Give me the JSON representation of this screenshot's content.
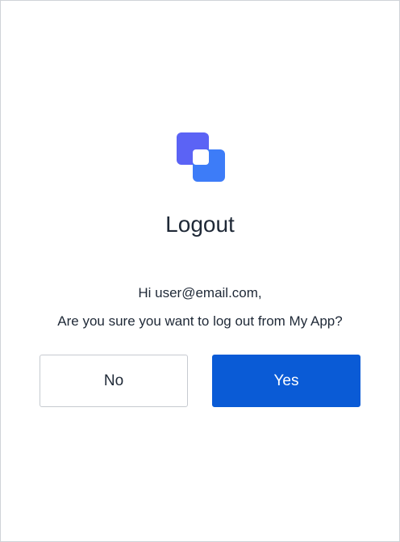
{
  "dialog": {
    "title": "Logout",
    "greeting": "Hi user@email.com,",
    "question": "Are you sure you want to log out from My App?",
    "no_label": "No",
    "yes_label": "Yes"
  },
  "logo": {
    "icon": "app-logo-icon",
    "color_top": "#5b63f5",
    "color_bottom": "#3d7cf8"
  },
  "colors": {
    "primary": "#0a5bd6",
    "text": "#1f2937",
    "border": "#c6cad0"
  }
}
